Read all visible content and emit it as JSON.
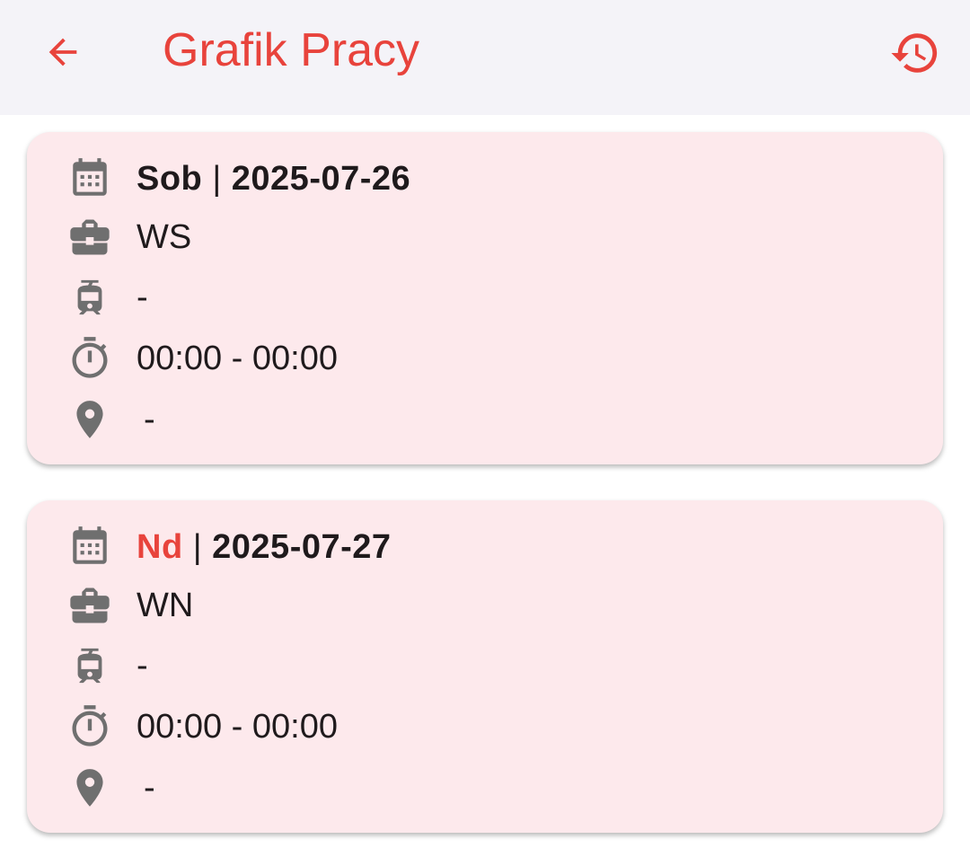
{
  "header": {
    "title": "Grafik Pracy",
    "back_icon": "arrow-left-icon",
    "history_icon": "history-icon"
  },
  "colors": {
    "accent": "#e8433c",
    "card_bg": "#fde9ec",
    "icon_gray": "#6f6f6f",
    "appbar_bg": "#f4f3f8"
  },
  "cards": [
    {
      "day": "Sob",
      "separator": "|",
      "date": "2025-07-26",
      "day_highlight": false,
      "work_code": "WS",
      "train": "-",
      "hours": "00:00 - 00:00",
      "location": "-"
    },
    {
      "day": "Nd",
      "separator": "|",
      "date": "2025-07-27",
      "day_highlight": true,
      "work_code": "WN",
      "train": "-",
      "hours": "00:00 - 00:00",
      "location": "-"
    }
  ]
}
